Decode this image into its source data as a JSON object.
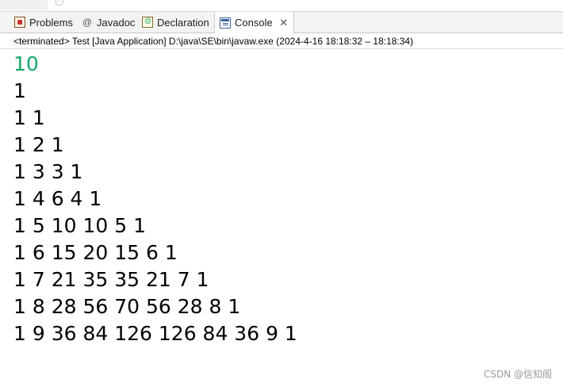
{
  "tabs": [
    {
      "id": "problems",
      "label": "Problems",
      "icon": "problems-icon"
    },
    {
      "id": "javadoc",
      "label": "Javadoc",
      "icon": "at-sign-icon",
      "glyph": "@"
    },
    {
      "id": "declaration",
      "label": "Declaration",
      "icon": "declaration-icon"
    },
    {
      "id": "console",
      "label": "Console",
      "icon": "console-icon",
      "close": "✕"
    }
  ],
  "status": "<terminated> Test [Java Application] D:\\java\\SE\\bin\\javaw.exe  (2024-4-16 18:18:32 – 18:18:34)",
  "console": {
    "input": "10",
    "output": [
      "1",
      "1 1",
      "1 2 1",
      "1 3 3 1",
      "1 4 6 4 1",
      "1 5 10 10 5 1",
      "1 6 15 20 15 6 1",
      "1 7 21 35 35 21 7 1",
      "1 8 28 56 70 56 28 8 1",
      "1 9 36 84 126 126 84 36 9 1"
    ]
  },
  "watermark": "CSDN @信知阁",
  "colors": {
    "input_text": "#13a86a",
    "output_text": "#000000"
  }
}
